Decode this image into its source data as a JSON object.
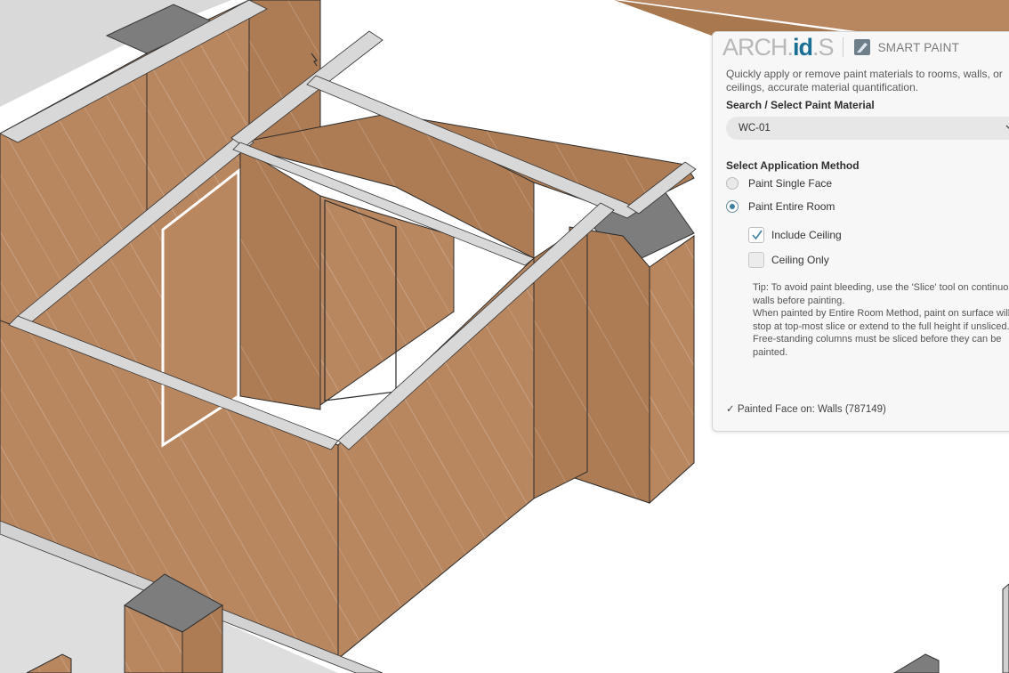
{
  "panel": {
    "logo": {
      "part1": "ARCH",
      "dot": ".",
      "part2": "id",
      "part3": "S"
    },
    "tool_icon": "smart-paint-icon",
    "tool_title": "SMART PAINT",
    "description": "Quickly apply or remove paint materials to rooms, walls, or ceilings, accurate material quantification.",
    "search_label": "Search / Select Paint Material",
    "material_value": "WC-01",
    "method_label": "Select Application Method",
    "options": [
      {
        "label": "Paint Single Face",
        "selected": false
      },
      {
        "label": "Paint Entire Room",
        "selected": true
      }
    ],
    "sub_options": [
      {
        "label": "Include Ceiling",
        "checked": true
      },
      {
        "label": "Ceiling Only",
        "checked": false
      }
    ],
    "tip": "Tip: To avoid paint bleeding, use the 'Slice' tool on continuous walls before painting.\nWhen painted by Entire Room Method, paint on surface will stop at top-most slice or extend to the full height if unsliced. Free-standing columns must be sliced before they can be painted.",
    "status": "✓ Painted Face on: Walls (787149)"
  },
  "colors": {
    "wall": "#b8865f",
    "wall_shade": "#a9784f",
    "floor_grey": "#d9d9d9",
    "cap": "#7d7d7d",
    "accent": "#1b6f95"
  }
}
